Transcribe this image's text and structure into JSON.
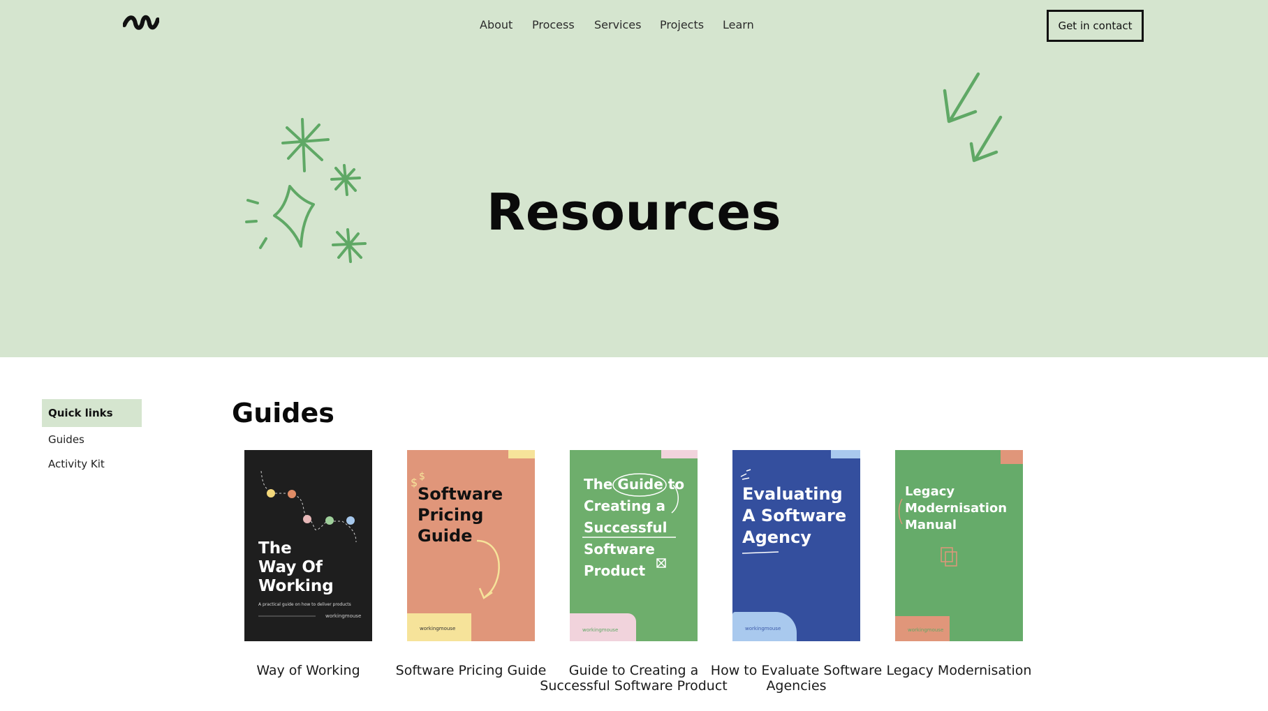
{
  "nav": {
    "items": [
      "About",
      "Process",
      "Services",
      "Projects",
      "Learn"
    ],
    "cta_label": "Get in contact"
  },
  "hero": {
    "title": "Resources"
  },
  "sidebar": {
    "heading": "Quick links",
    "links": [
      "Guides",
      "Activity Kit"
    ]
  },
  "guides": {
    "heading": "Guides",
    "items": [
      {
        "caption": "Way of Working",
        "cover_lines": [
          "The",
          "Way Of",
          "Working"
        ],
        "subtitle": "A practical guide on how to deliver products",
        "brand": "workingmouse",
        "bg": "#1e1e1e"
      },
      {
        "caption": "Software Pricing Guide",
        "cover_lines": [
          "Software",
          "Pricing",
          "Guide"
        ],
        "brand": "workingmouse",
        "bg": "#e0967a"
      },
      {
        "caption": "Guide to Creating a Successful Software Product",
        "cover_lines": [
          "The Guide to",
          "Creating a",
          "Successful",
          "Software",
          "Product"
        ],
        "brand": "workingmouse",
        "bg": "#6eae6c"
      },
      {
        "caption": "How to Evaluate Software Agencies",
        "cover_lines": [
          "Evaluating",
          "A Software",
          "Agency"
        ],
        "brand": "workingmouse",
        "bg": "#344f9e"
      },
      {
        "caption": "Legacy Modernisation",
        "cover_lines": [
          "Legacy",
          "Modernisation",
          "Manual"
        ],
        "brand": "workingmouse",
        "bg": "#66ab6a"
      }
    ]
  },
  "colors": {
    "hero_bg": "#d5e5cf",
    "doodle_green": "#5fa865",
    "text": "#0a0a0a"
  },
  "icons": [
    "logo-icon",
    "sparkle-doodle-icon",
    "arrow-doodle-icon"
  ]
}
